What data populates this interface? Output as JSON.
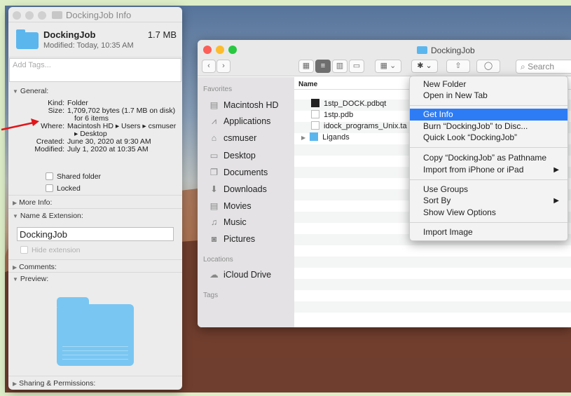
{
  "accent": "#2d7cf6",
  "info": {
    "title": "DockingJob Info",
    "name": "DockingJob",
    "size": "1.7 MB",
    "modified": "Modified: Today, 10:35 AM",
    "tags_placeholder": "Add Tags...",
    "general": "General:",
    "kind_k": "Kind:",
    "kind_v": "Folder",
    "size_k": "Size:",
    "size_v": "1,709,702 bytes (1.7 MB on disk)",
    "size_v2": "for 6 items",
    "where_k": "Where:",
    "where_v": "Macintosh HD ▸ Users ▸ csmuser",
    "where_v2": "▸ Desktop",
    "created_k": "Created:",
    "created_v": "June 30, 2020 at 9:30 AM",
    "modk": "Modified:",
    "modv": "July 1, 2020 at 10:35 AM",
    "shared": "Shared folder",
    "locked": "Locked",
    "more": "More Info:",
    "nameext": "Name & Extension:",
    "nameext_value": "DockingJob",
    "hide_ext": "Hide extension",
    "comments": "Comments:",
    "preview": "Preview:",
    "sharing": "Sharing & Permissions:"
  },
  "finder": {
    "title": "DockingJob",
    "search": "Search",
    "favorites": "Favorites",
    "sidebar": [
      {
        "label": "Macintosh HD",
        "icon": "disk-icon"
      },
      {
        "label": "Applications",
        "icon": "applications-icon"
      },
      {
        "label": "csmuser",
        "icon": "home-icon"
      },
      {
        "label": "Desktop",
        "icon": "desktop-icon"
      },
      {
        "label": "Documents",
        "icon": "documents-icon"
      },
      {
        "label": "Downloads",
        "icon": "downloads-icon"
      },
      {
        "label": "Movies",
        "icon": "movies-icon"
      },
      {
        "label": "Music",
        "icon": "music-icon"
      },
      {
        "label": "Pictures",
        "icon": "pictures-icon"
      }
    ],
    "locations": "Locations",
    "icloud": "iCloud Drive",
    "tags": "Tags",
    "col_name": "Name",
    "files": [
      "1stp_DOCK.pdbqt",
      "1stp.pdb",
      "idock_programs_Unix.ta",
      "Ligands"
    ]
  },
  "menu": {
    "items": [
      "New Folder",
      "Open in New Tab",
      "Get Info",
      "Burn “DockingJob” to Disc...",
      "Quick Look “DockingJob”",
      "Copy “DockingJob” as Pathname",
      "Import from iPhone or iPad",
      "Use Groups",
      "Sort By",
      "Show View Options",
      "Import Image"
    ],
    "submenu_arrow": "▶"
  }
}
